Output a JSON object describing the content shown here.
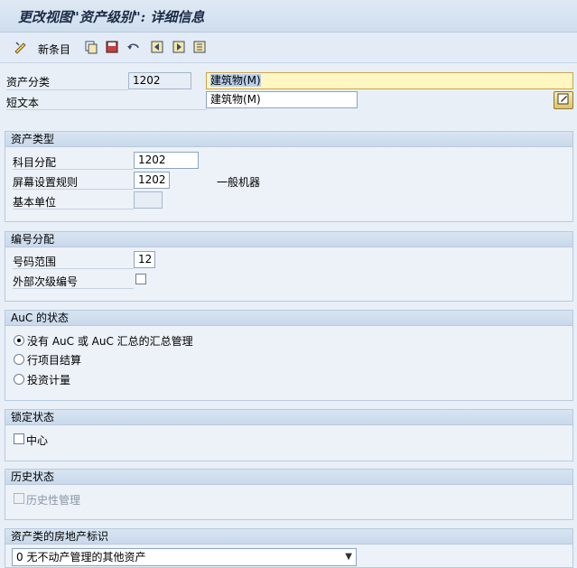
{
  "window": {
    "title": "更改视图\"资产级别\": 详细信息"
  },
  "toolbar": {
    "new_entries_label": "新条目",
    "icons": [
      "edit-toggle-icon",
      "copy-icon",
      "save-as-icon",
      "undo-icon",
      "first-icon",
      "previous-icon",
      "next-icon"
    ]
  },
  "header": {
    "asset_class_label": "资产分类",
    "asset_class_value": "1202",
    "asset_class_desc": "建筑物(M)",
    "short_text_label": "短文本",
    "short_text_value": "建筑物(M)"
  },
  "asset_type": {
    "title": "资产类型",
    "account_determination_label": "科目分配",
    "account_determination_value": "1202",
    "screen_layout_label": "屏幕设置规则",
    "screen_layout_value": "1202",
    "screen_layout_desc": "一般机器",
    "base_unit_label": "基本单位",
    "base_unit_value": ""
  },
  "number_assignment": {
    "title": "编号分配",
    "number_range_label": "号码范围",
    "number_range_value": "12",
    "external_sub_label": "外部次级编号",
    "external_sub_checked": false
  },
  "auc_status": {
    "title": "AuC 的状态",
    "options": [
      "没有 AuC 或 AuC 汇总的汇总管理",
      "行项目结算",
      "投资计量"
    ],
    "selected_index": 0
  },
  "lock_status": {
    "title": "锁定状态",
    "center_label": "中心",
    "center_checked": false
  },
  "history_status": {
    "title": "历史状态",
    "history_label": "历史性管理",
    "history_checked": false,
    "history_enabled": false
  },
  "real_estate": {
    "title": "资产类的房地产标识",
    "selected_value": "0 无不动产管理的其他资产"
  },
  "colors": {
    "background": "#e8eff7",
    "group_header": "#c9d9eb",
    "focus_field": "#fff6c2"
  }
}
